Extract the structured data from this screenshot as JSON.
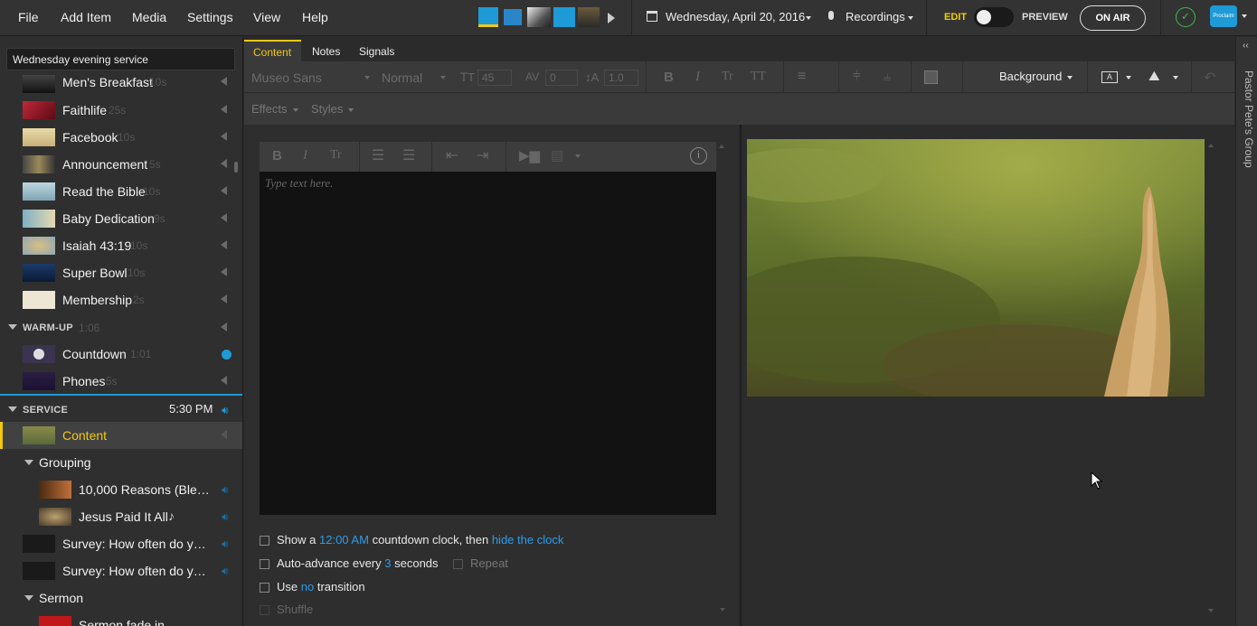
{
  "menu": [
    "File",
    "Add Item",
    "Media",
    "Settings",
    "View",
    "Help"
  ],
  "header": {
    "date": "Wednesday, April 20, 2016",
    "recordings": "Recordings",
    "edit": "EDIT",
    "preview": "PREVIEW",
    "on_air": "ON AIR",
    "proclaim_badge": "Proclaim"
  },
  "sidebar": {
    "service_name": "Wednesday evening service",
    "items_top": [
      {
        "label": "Men's Breakfast",
        "dur": "10s"
      },
      {
        "label": "Faithlife",
        "dur": "25s"
      },
      {
        "label": "Facebook",
        "dur": "10s"
      },
      {
        "label": "Announcement",
        "dur": "5s"
      },
      {
        "label": "Read the Bible",
        "dur": "10s"
      },
      {
        "label": "Baby Dedication",
        "dur": "9s"
      },
      {
        "label": "Isaiah 43:19",
        "dur": "10s"
      },
      {
        "label": "Super Bowl",
        "dur": "10s"
      },
      {
        "label": "Membership",
        "dur": "2s"
      }
    ],
    "warmup": {
      "label": "WARM-UP",
      "dur": "1:06"
    },
    "warmup_items": [
      {
        "label": "Countdown",
        "dur": "1:01"
      },
      {
        "label": "Phones",
        "dur": "5s"
      }
    ],
    "service": {
      "label": "SERVICE",
      "time": "5:30 PM"
    },
    "service_items": {
      "content": "Content",
      "grouping": "Grouping",
      "reasons": "10,000 Reasons (Ble…",
      "jesus": "Jesus Paid It All",
      "survey1": "Survey: How often do y…",
      "survey2": "Survey: How often do y…",
      "sermon": "Sermon",
      "sermon_fade": "Sermon fade in"
    }
  },
  "tabs": [
    "Content",
    "Notes",
    "Signals"
  ],
  "toolbar": {
    "font": "Museo Sans",
    "weight": "Normal",
    "size": "45",
    "spacing": "0",
    "line_height": "1.0",
    "background": "Background",
    "effects": "Effects",
    "styles": "Styles"
  },
  "editor": {
    "placeholder": "Type text here."
  },
  "options": {
    "countdown_pre": "Show a",
    "countdown_time": "12:00 AM",
    "countdown_mid": "countdown clock, then",
    "countdown_link": "hide the clock",
    "advance_pre": "Auto-advance every",
    "advance_num": "3",
    "advance_post": "seconds",
    "repeat": "Repeat",
    "use_pre": "Use",
    "use_link": "no",
    "use_post": "transition",
    "shuffle": "Shuffle"
  },
  "side_group": "Pastor Pete's Group",
  "colors": {
    "accent_blue": "#2f9be8",
    "edit_yellow": "#f0d000",
    "selected_yellow": "#f2c811",
    "ok_green": "#3fba4a"
  }
}
